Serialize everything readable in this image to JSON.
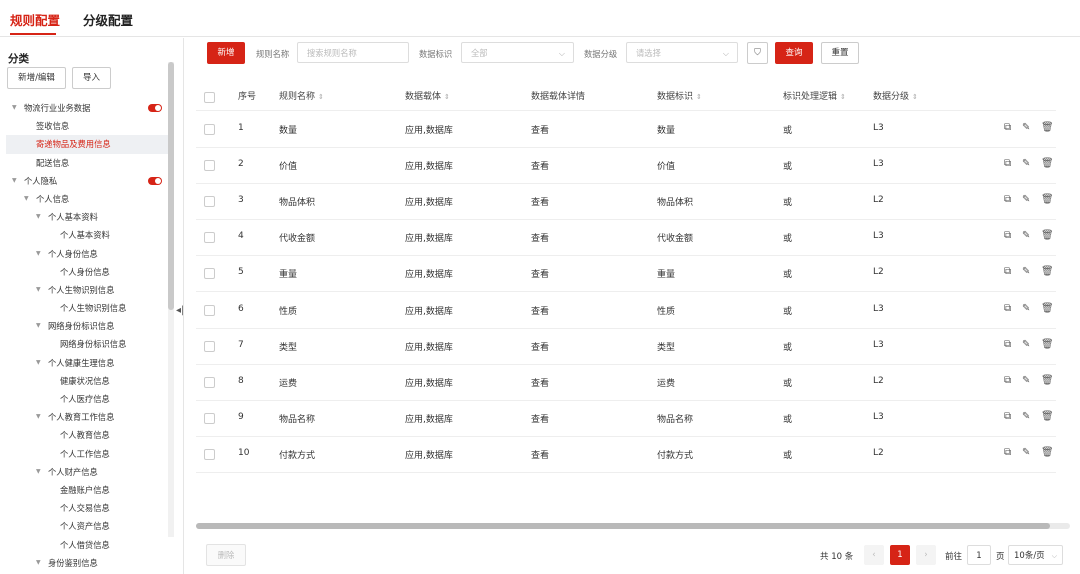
{
  "tabs": [
    "规则配置",
    "分级配置"
  ],
  "sidebar": {
    "title": "分类",
    "add_edit_label": "新增/编辑",
    "import_label": "导入",
    "tree": [
      {
        "label": "物流行业业务数据",
        "level": 0,
        "caret": true,
        "toggle": true
      },
      {
        "label": "签收信息",
        "level": 1
      },
      {
        "label": "寄递物品及费用信息",
        "level": 1,
        "selected": true
      },
      {
        "label": "配送信息",
        "level": 1
      },
      {
        "label": "个人隐私",
        "level": 0,
        "caret": true,
        "toggle": true
      },
      {
        "label": "个人信息",
        "level": 1,
        "caret": true
      },
      {
        "label": "个人基本资料",
        "level": 2,
        "caret": true
      },
      {
        "label": "个人基本资料",
        "level": 3
      },
      {
        "label": "个人身份信息",
        "level": 2,
        "caret": true
      },
      {
        "label": "个人身份信息",
        "level": 3
      },
      {
        "label": "个人生物识别信息",
        "level": 2,
        "caret": true
      },
      {
        "label": "个人生物识别信息",
        "level": 3
      },
      {
        "label": "网络身份标识信息",
        "level": 2,
        "caret": true
      },
      {
        "label": "网络身份标识信息",
        "level": 3
      },
      {
        "label": "个人健康生理信息",
        "level": 2,
        "caret": true
      },
      {
        "label": "健康状况信息",
        "level": 3
      },
      {
        "label": "个人医疗信息",
        "level": 3
      },
      {
        "label": "个人教育工作信息",
        "level": 2,
        "caret": true
      },
      {
        "label": "个人教育信息",
        "level": 3
      },
      {
        "label": "个人工作信息",
        "level": 3
      },
      {
        "label": "个人财产信息",
        "level": 2,
        "caret": true
      },
      {
        "label": "金融账户信息",
        "level": 3
      },
      {
        "label": "个人交易信息",
        "level": 3
      },
      {
        "label": "个人资产信息",
        "level": 3
      },
      {
        "label": "个人借贷信息",
        "level": 3
      },
      {
        "label": "身份鉴别信息",
        "level": 2,
        "caret": true
      }
    ]
  },
  "toolbar": {
    "new_label": "新增",
    "rule_name_label": "规则名称",
    "rule_name_placeholder": "搜索规则名称",
    "data_tag_label": "数据标识",
    "data_tag_value": "全部",
    "data_level_label": "数据分级",
    "data_level_placeholder": "请选择",
    "query_label": "查询",
    "reset_label": "重置"
  },
  "table": {
    "headers": [
      "序号",
      "规则名称",
      "数据载体",
      "数据载体详情",
      "数据标识",
      "标识处理逻辑",
      "数据分级"
    ],
    "rows": [
      [
        "1",
        "数量",
        "应用,数据库",
        "查看",
        "数量",
        "或",
        "L3"
      ],
      [
        "2",
        "价值",
        "应用,数据库",
        "查看",
        "价值",
        "或",
        "L3"
      ],
      [
        "3",
        "物品体积",
        "应用,数据库",
        "查看",
        "物品体积",
        "或",
        "L2"
      ],
      [
        "4",
        "代收金额",
        "应用,数据库",
        "查看",
        "代收金额",
        "或",
        "L3"
      ],
      [
        "5",
        "重量",
        "应用,数据库",
        "查看",
        "重量",
        "或",
        "L2"
      ],
      [
        "6",
        "性质",
        "应用,数据库",
        "查看",
        "性质",
        "或",
        "L3"
      ],
      [
        "7",
        "类型",
        "应用,数据库",
        "查看",
        "类型",
        "或",
        "L3"
      ],
      [
        "8",
        "运费",
        "应用,数据库",
        "查看",
        "运费",
        "或",
        "L2"
      ],
      [
        "9",
        "物品名称",
        "应用,数据库",
        "查看",
        "物品名称",
        "或",
        "L3"
      ],
      [
        "10",
        "付款方式",
        "应用,数据库",
        "查看",
        "付款方式",
        "或",
        "L2"
      ]
    ]
  },
  "footer": {
    "delete_label": "删除",
    "total_text": "共 10 条",
    "current_page": "1",
    "goto_label": "前往",
    "goto_value": "1",
    "page_unit": "页",
    "page_size": "10条/页"
  },
  "colors": {
    "accent": "#d62416"
  }
}
